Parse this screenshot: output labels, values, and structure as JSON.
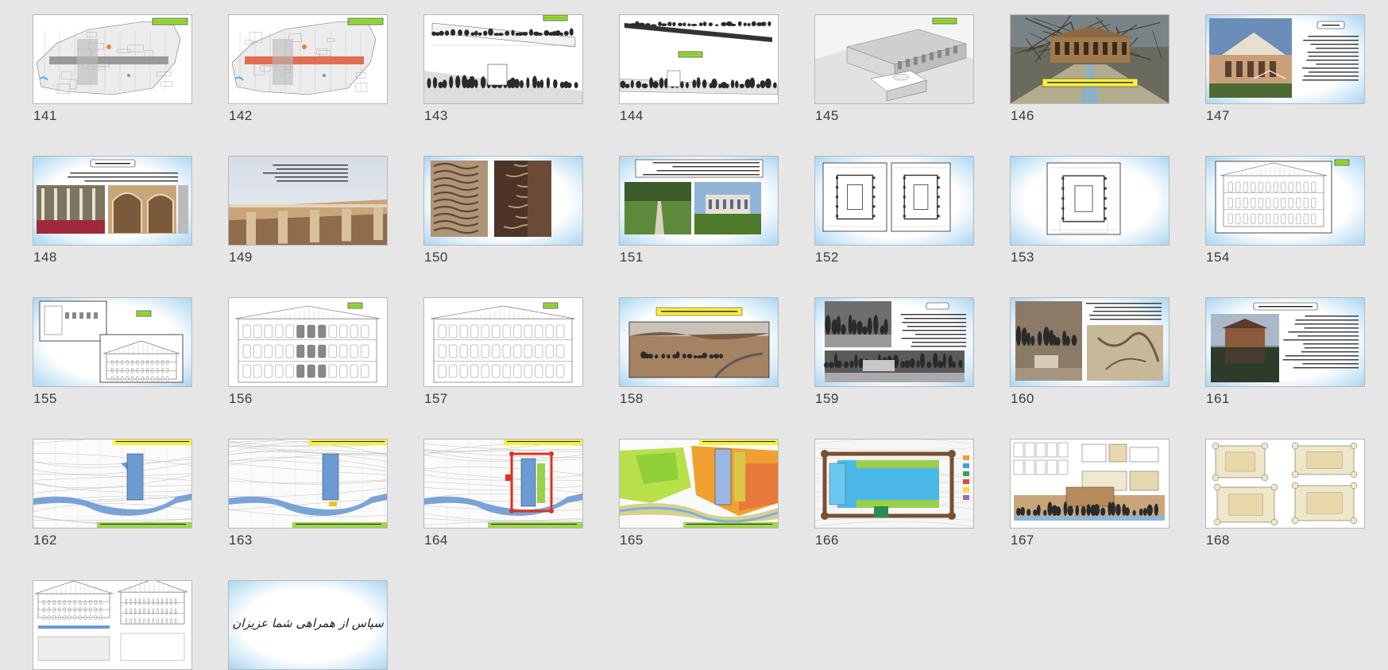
{
  "slides": [
    {
      "number": "141",
      "kind": "plan-gray",
      "tag": "زمان مجموعه باغ"
    },
    {
      "number": "142",
      "kind": "plan-red",
      "tag": "زمان مجموعه باغ"
    },
    {
      "number": "143",
      "kind": "section",
      "tag": "مقاطع و ارتفاعات"
    },
    {
      "number": "144",
      "kind": "section2",
      "tag": "مقاطع و ارتفاعات",
      "tag2": "مقاطع و ارتفاعات"
    },
    {
      "number": "145",
      "kind": "render",
      "tag": "سه بعدی مجموعه"
    },
    {
      "number": "146",
      "kind": "photo-palace",
      "tag": "۱۱- طرح مرمت و احیاء عمارت باغ فردوس (حوزه میانه)"
    },
    {
      "number": "147",
      "kind": "photo-text",
      "tag": "تاریخچه"
    },
    {
      "number": "148",
      "kind": "two-photos-text",
      "tag": "تزئینات عناصر گچبری"
    },
    {
      "number": "149",
      "kind": "photo-balcony"
    },
    {
      "number": "150",
      "kind": "stucco"
    },
    {
      "number": "151",
      "kind": "garden-photos"
    },
    {
      "number": "152",
      "kind": "two-plans"
    },
    {
      "number": "153",
      "kind": "one-plan"
    },
    {
      "number": "154",
      "kind": "elevation-blue",
      "tag": "نما"
    },
    {
      "number": "155",
      "kind": "two-elevations",
      "tag": "نما"
    },
    {
      "number": "156",
      "kind": "elevation-white",
      "tag": "نما"
    },
    {
      "number": "157",
      "kind": "elevation-white2",
      "tag": "نما"
    },
    {
      "number": "158",
      "kind": "desert-photo",
      "tag": "۱۲- طرح مرمت و ساماندهی باغ تاریخی چشمه علی دامغان"
    },
    {
      "number": "159",
      "kind": "bw-photos",
      "tag": "معرفی"
    },
    {
      "number": "160",
      "kind": "sepia-photos"
    },
    {
      "number": "161",
      "kind": "lake-house",
      "tag": "طرح مرمت احیاء و ساماندهی باغ چشمه علی"
    },
    {
      "number": "162",
      "kind": "site-river",
      "tag": "بررسی وضعیت کیفیت باغ تاریخی چشمه علی دامغان",
      "footer": "جهت تبیین اهمیت دهی منطقه چشمه شرقی"
    },
    {
      "number": "163",
      "kind": "site-river2",
      "tag": "بررسی وضعیت کیفیت باغ تاریخی چشمه علی دامغان",
      "footer": "جهت تبیین اهمیت دهی منطقه چشمه شرقی"
    },
    {
      "number": "164",
      "kind": "site-red",
      "tag": "بررسی وضعیت کیفیت باغ تاریخی چشمه علی دامغان",
      "footer": "جهت تبیین اهمیت دهی منطقه چشمه شرقی"
    },
    {
      "number": "165",
      "kind": "site-color",
      "tag": "بررسی وضعیت کیفیت باغ تاریخی چشمه علی دامغان",
      "footer": "جهت تبیین اهمیت دهی منطقه چشمه شرقی"
    },
    {
      "number": "166",
      "kind": "pool-plan"
    },
    {
      "number": "167",
      "kind": "drawings-sheet",
      "labels": [
        "Pavilion Plans",
        "Entrance Pavilion Plans",
        "Site Section"
      ]
    },
    {
      "number": "168",
      "kind": "beige-plans"
    },
    {
      "number": "",
      "kind": "elev-sheet"
    },
    {
      "number": "",
      "kind": "thanks",
      "text": "سپاس از همراهی شما عزیزان"
    }
  ]
}
